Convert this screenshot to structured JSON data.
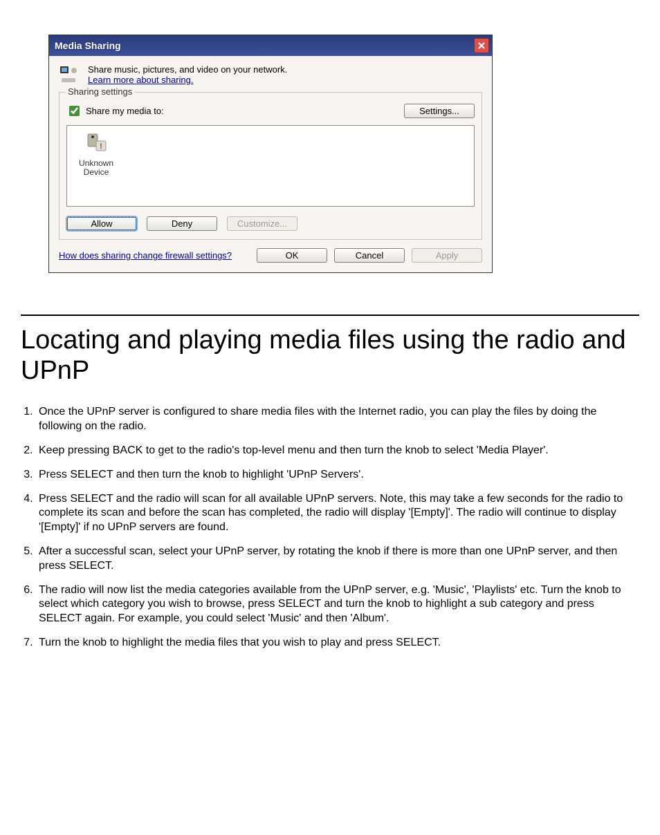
{
  "dialog": {
    "title": "Media Sharing",
    "close_label": "X",
    "intro_line": "Share music, pictures, and video on your network.",
    "learn_link": "Learn more about sharing.",
    "fieldset_legend": "Sharing settings",
    "share_checkbox_label": "Share my media to:",
    "share_checked": true,
    "settings_button": "Settings...",
    "device": {
      "name": "Unknown Device"
    },
    "allow_button": "Allow",
    "deny_button": "Deny",
    "customize_button": "Customize...",
    "firewall_link": "How does sharing change firewall settings?",
    "ok_button": "OK",
    "cancel_button": "Cancel",
    "apply_button": "Apply"
  },
  "document": {
    "heading": "Locating and playing media files using the radio and UPnP",
    "steps": [
      "Once the UPnP server is configured to share media files with the Internet radio, you can play the files by doing the following on the radio.",
      "Keep pressing BACK to get to the radio's top-level menu and then turn the knob to select 'Media Player'.",
      "Press SELECT and then turn the knob to highlight 'UPnP Servers'.",
      "Press SELECT and the radio will scan for all available UPnP servers. Note, this may take a few seconds for the radio to complete its scan and before the scan has completed, the radio will display '[Empty]'. The radio will continue to display '[Empty]' if no UPnP servers are found.",
      "After a successful scan, select your UPnP server, by rotating the knob if there is more than one UPnP server, and then press SELECT.",
      "The radio will now list the media categories available from the UPnP server, e.g. 'Music', 'Playlists' etc. Turn the knob to select which category you wish to browse, press SELECT and turn the knob to highlight a sub category and press SELECT again. For example, you could select 'Music' and then 'Album'.",
      "Turn the knob to highlight the media files that you wish to play and press SELECT."
    ]
  }
}
